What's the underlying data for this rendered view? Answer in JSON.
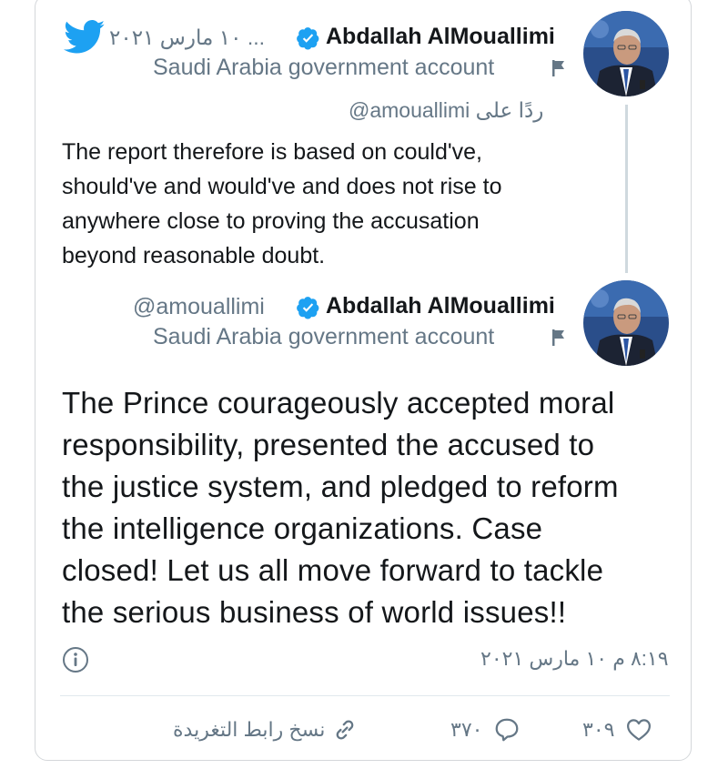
{
  "colors": {
    "twitter_blue": "#1da1f2",
    "verified_blue": "#1da1f2",
    "text_primary": "#14171a",
    "text_muted": "#657786"
  },
  "parent_tweet": {
    "author_name": "Abdallah AlMouallimi",
    "date": "... ١٠ مارس ٢٠٢١",
    "account_label": "Saudi Arabia government account",
    "reply_prefix": "ردًا على",
    "reply_handle": "@amouallimi",
    "text": "The report therefore is based on could've, should've and would've and does not rise to anywhere close to proving the accusation beyond reasonable doubt.",
    "lines": [
      "The report therefore is based on could've,",
      "should've and would've and does not rise to",
      "anywhere close to proving the accusation",
      "beyond reasonable doubt."
    ]
  },
  "main_tweet": {
    "author_name": "Abdallah AlMouallimi",
    "handle": "@amouallimi",
    "account_label": "Saudi Arabia government account",
    "lines": [
      "The Prince courageously accepted moral",
      "responsibility, presented the accused to",
      "the justice system, and pledged to reform",
      "the intelligence organizations. Case",
      "closed! Let us all move forward to tackle",
      "the serious business of world issues!!"
    ],
    "timestamp": "٨:١٩ م ١٠ مارس ٢٠٢١"
  },
  "actions": {
    "likes_count": "٣٠٩",
    "replies_count": "٣٧٠",
    "copy_link_label": "نسخ رابط التغريدة"
  },
  "icons": {
    "app": "twitter-bird-icon",
    "verified": "verified-badge-icon",
    "flag": "flag-icon",
    "info": "info-icon",
    "like": "heart-icon",
    "reply": "speech-bubble-icon",
    "link": "link-icon"
  }
}
